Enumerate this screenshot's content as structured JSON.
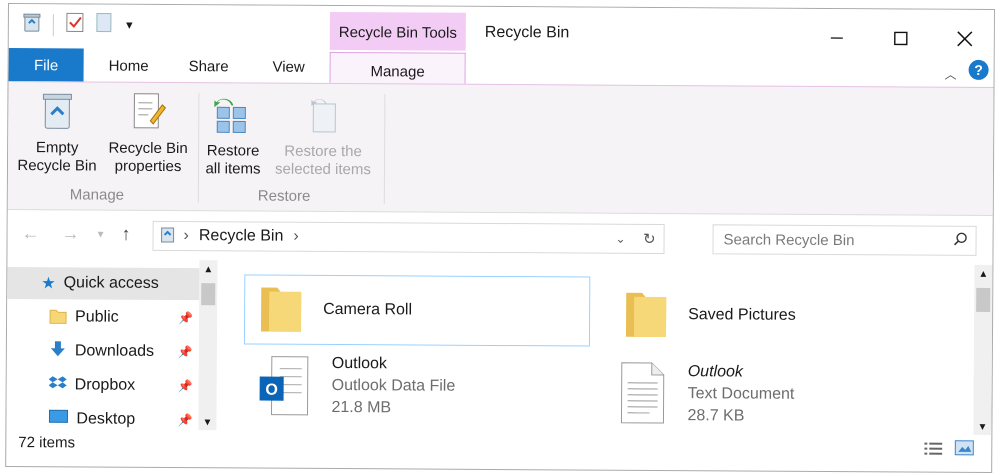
{
  "window": {
    "title": "Recycle Bin",
    "contextual_tab_group": "Recycle Bin Tools"
  },
  "tabs": [
    {
      "label": "File"
    },
    {
      "label": "Home"
    },
    {
      "label": "Share"
    },
    {
      "label": "View"
    },
    {
      "label": "Manage"
    }
  ],
  "ribbon": {
    "manage_group": {
      "label": "Manage",
      "empty_line1": "Empty",
      "empty_line2": "Recycle Bin",
      "props_line1": "Recycle Bin",
      "props_line2": "properties"
    },
    "restore_group": {
      "label": "Restore",
      "restore_all_line1": "Restore",
      "restore_all_line2": "all items",
      "restore_sel_line1": "Restore the",
      "restore_sel_line2": "selected items"
    }
  },
  "address": {
    "path": "Recycle Bin",
    "search_placeholder": "Search Recycle Bin"
  },
  "nav_pane": {
    "items": [
      {
        "label": "Quick access",
        "icon": "star-icon"
      },
      {
        "label": "Public",
        "icon": "folder-icon"
      },
      {
        "label": "Downloads",
        "icon": "download-icon"
      },
      {
        "label": "Dropbox",
        "icon": "dropbox-icon"
      },
      {
        "label": "Desktop",
        "icon": "desktop-icon"
      }
    ]
  },
  "files": [
    {
      "name": "Camera Roll",
      "icon": "folder-icon"
    },
    {
      "name": "Saved Pictures",
      "icon": "folder-icon"
    },
    {
      "name": "Outlook",
      "type": "Outlook Data File",
      "size": "21.8 MB",
      "icon": "outlook-data-file-icon"
    },
    {
      "name": "Outlook",
      "type": "Text Document",
      "size": "28.7 KB",
      "icon": "text-document-icon"
    }
  ],
  "status": {
    "item_count": "72 items"
  },
  "colors": {
    "file_tab": "#1979ca",
    "contextual_tab": "#f3ccf5",
    "accent_blue": "#1979ca"
  }
}
